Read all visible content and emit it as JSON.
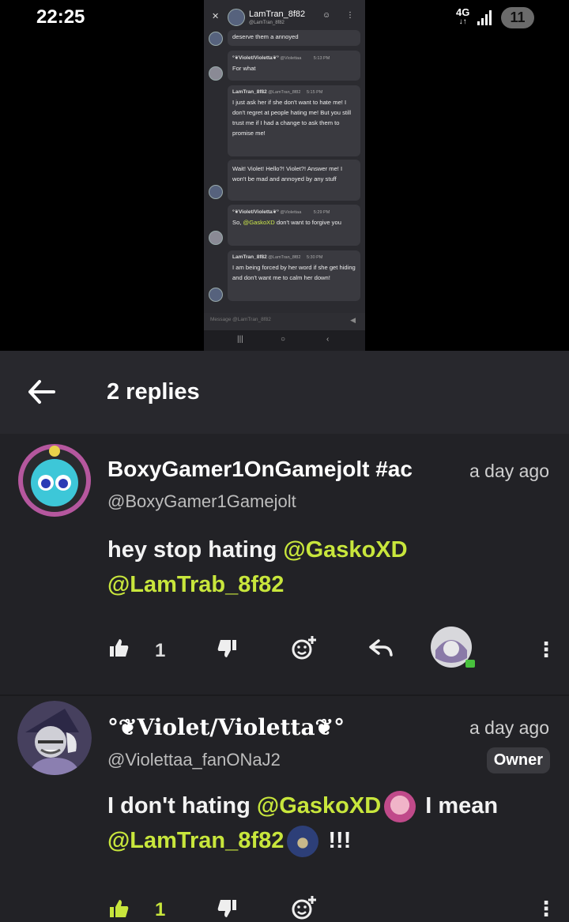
{
  "status_bar": {
    "time": "22:25",
    "network": "4G",
    "battery": "11"
  },
  "embedded_screenshot": {
    "chat_name": "LamTran_8f82",
    "chat_handle": "@LamTran_8f82",
    "messages": [
      {
        "author": "",
        "handle": "",
        "time": "",
        "text": "deserve them a annoyed"
      },
      {
        "author": "°❦Violet/Violetta❦°",
        "handle": "@Violettaa",
        "time": "5:13 PM",
        "text": "For what"
      },
      {
        "author": "LamTran_8f82",
        "handle": "@LamTran_8f82",
        "time": "5:15 PM",
        "text": "I just ask her if she don't want to hate me! I don't regret at people hating me! But you still trust me if I had a change to ask them to promise me!"
      },
      {
        "author": "",
        "handle": "",
        "time": "",
        "text": "Wait! Violet! Hello?! Violet?! Answer me! I won't be mad and annoyed by any stuff"
      },
      {
        "author": "°❦Violet/Violetta❦°",
        "handle": "@Violettaa",
        "time": "5:29 PM",
        "text_before": "So, ",
        "mention": "@GaskoXD",
        "text_after": " don't want to forgive you"
      },
      {
        "author": "LamTran_8f82",
        "handle": "@LamTran_8f82",
        "time": "5:30 PM",
        "text": "I am being forced by her word if she get hiding and don't want me to calm her down!"
      }
    ],
    "input_placeholder": "Message @LamTran_8f82"
  },
  "header": {
    "title": "2 replies"
  },
  "comments": [
    {
      "author": "BoxyGamer1OnGamejolt #ac",
      "handle": "@BoxyGamer1Gamejolt",
      "time": "a day ago",
      "body_text": "hey stop hating ",
      "mention_1": "@GaskoXD",
      "mention_2": "@LamTrab_8f82",
      "like_count": "1"
    },
    {
      "author": "°❦Violet/Violetta❦°",
      "handle": "@Violettaa_fanONaJ2",
      "time": "a day ago",
      "badge": "Owner",
      "body_text": "I don't hating ",
      "mention_1": "@GaskoXD",
      "body_mid": " I mean",
      "mention_2": "@LamTran_8f82",
      "body_end": " !!!",
      "like_count": "1"
    }
  ],
  "colors": {
    "mention": "#c8e63c",
    "liked": "#c8e63c",
    "panel": "#1f1f23"
  }
}
